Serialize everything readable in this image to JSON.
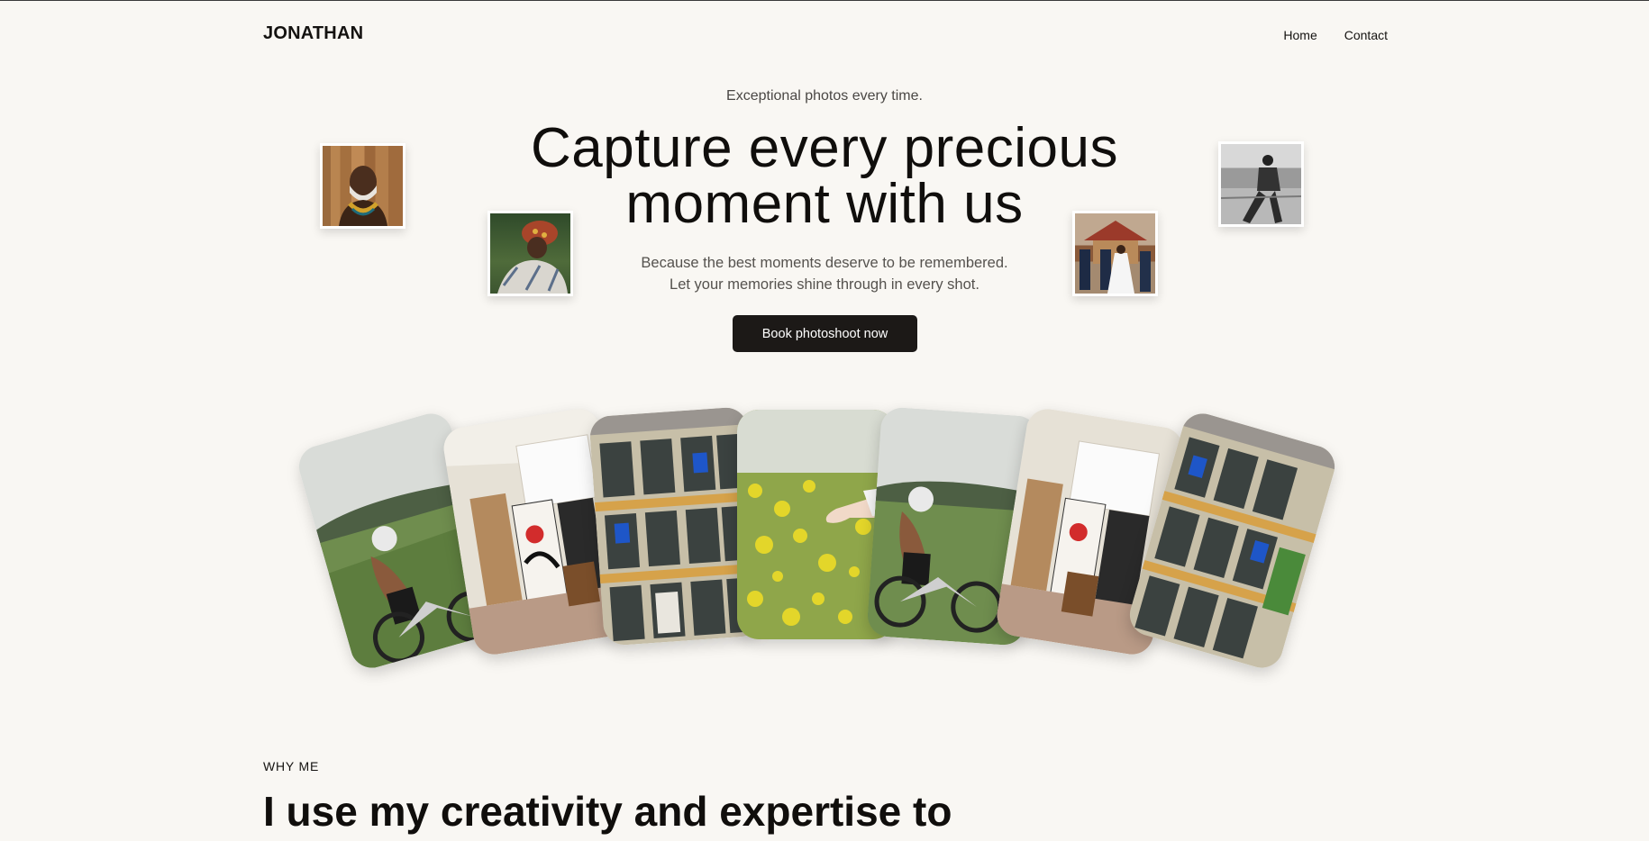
{
  "brand": {
    "name": "JONATHAN"
  },
  "nav": {
    "items": [
      "Home",
      "Contact"
    ]
  },
  "hero": {
    "eyebrow": "Exceptional photos every time.",
    "title_line1": "Capture every precious",
    "title_line2": "moment with us",
    "subtitle_line1": "Because the best moments deserve to be remembered.",
    "subtitle_line2": "Let your memories shine through in every shot.",
    "cta_label": "Book photoshoot now"
  },
  "polaroids": [
    {
      "name": "polaroid-elder-portrait",
      "subject": "elderly man portrait"
    },
    {
      "name": "polaroid-woman-headwrap",
      "subject": "woman with head wrap"
    },
    {
      "name": "polaroid-wedding",
      "subject": "wedding couple"
    },
    {
      "name": "polaroid-bw-man",
      "subject": "black and white man in field"
    }
  ],
  "strip": [
    {
      "name": "card-cyclist",
      "subject": "cyclist on a hill"
    },
    {
      "name": "card-studio",
      "subject": "artist studio"
    },
    {
      "name": "card-building",
      "subject": "building facade"
    },
    {
      "name": "card-flowers",
      "subject": "hand touching yellow flowers"
    },
    {
      "name": "card-cyclist-2",
      "subject": "cyclist on a hill"
    },
    {
      "name": "card-studio-2",
      "subject": "artist studio"
    },
    {
      "name": "card-building-2",
      "subject": "building facade"
    }
  ],
  "section": {
    "kicker": "WHY ME",
    "title": "I use my creativity and expertise to"
  },
  "colors": {
    "background": "#f9f7f3",
    "button": "#1c1917",
    "text": "#141210"
  }
}
